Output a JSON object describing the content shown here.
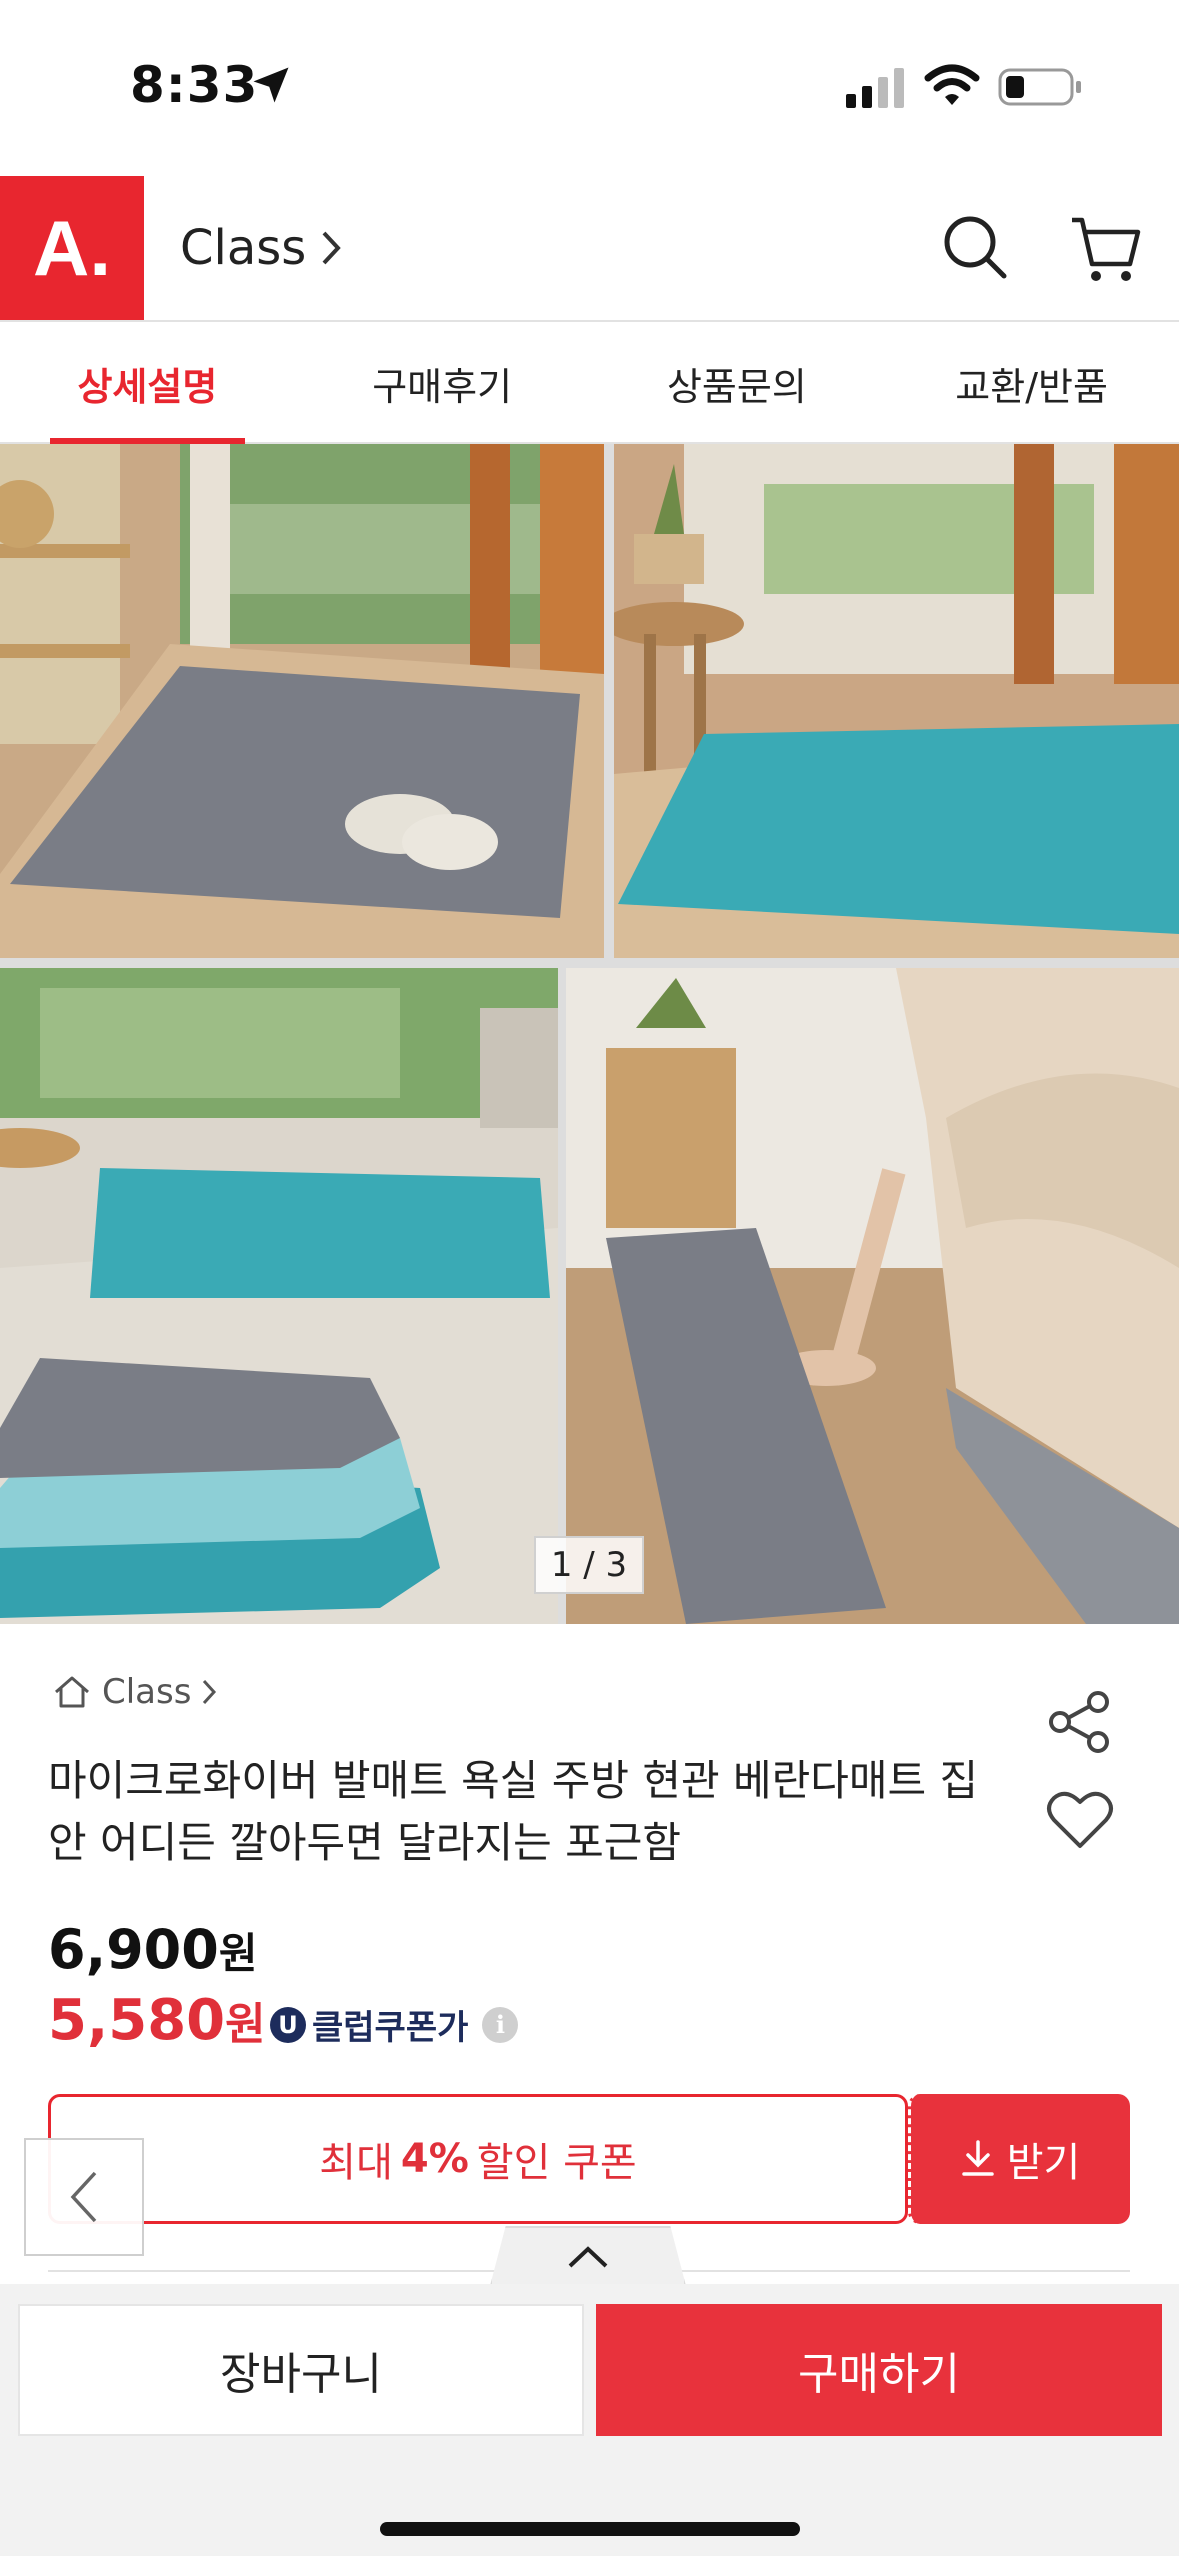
{
  "status_bar": {
    "time": "8:33"
  },
  "header": {
    "logo_text": "A.",
    "title": "Class"
  },
  "tabs": [
    {
      "label": "상세설명",
      "active": true
    },
    {
      "label": "구매후기",
      "active": false
    },
    {
      "label": "상품문의",
      "active": false
    },
    {
      "label": "교환/반품",
      "active": false
    }
  ],
  "gallery": {
    "pager": "1 / 3"
  },
  "product": {
    "breadcrumb": "Class",
    "title": "마이크로화이버 발매트 욕실 주방 현관 베란다매트 집안 어디든 깔아두면 달라지는 포근함",
    "price_original": "6,900",
    "price_sale": "5,580",
    "currency_unit": "원",
    "club_badge": "U",
    "club_label": "클럽쿠폰가",
    "info_glyph": "i"
  },
  "coupon": {
    "prefix": "최대",
    "percent": "4%",
    "suffix": "할인 쿠폰",
    "button_label": "받기"
  },
  "bottom_bar": {
    "cart_label": "장바구니",
    "buy_label": "구매하기"
  },
  "colors": {
    "brand_red": "#e8262f",
    "sale_red": "#e0303a",
    "club_navy": "#1d2c5c",
    "gray_mat": "#7a7d86",
    "teal_mat": "#3aaab5"
  }
}
